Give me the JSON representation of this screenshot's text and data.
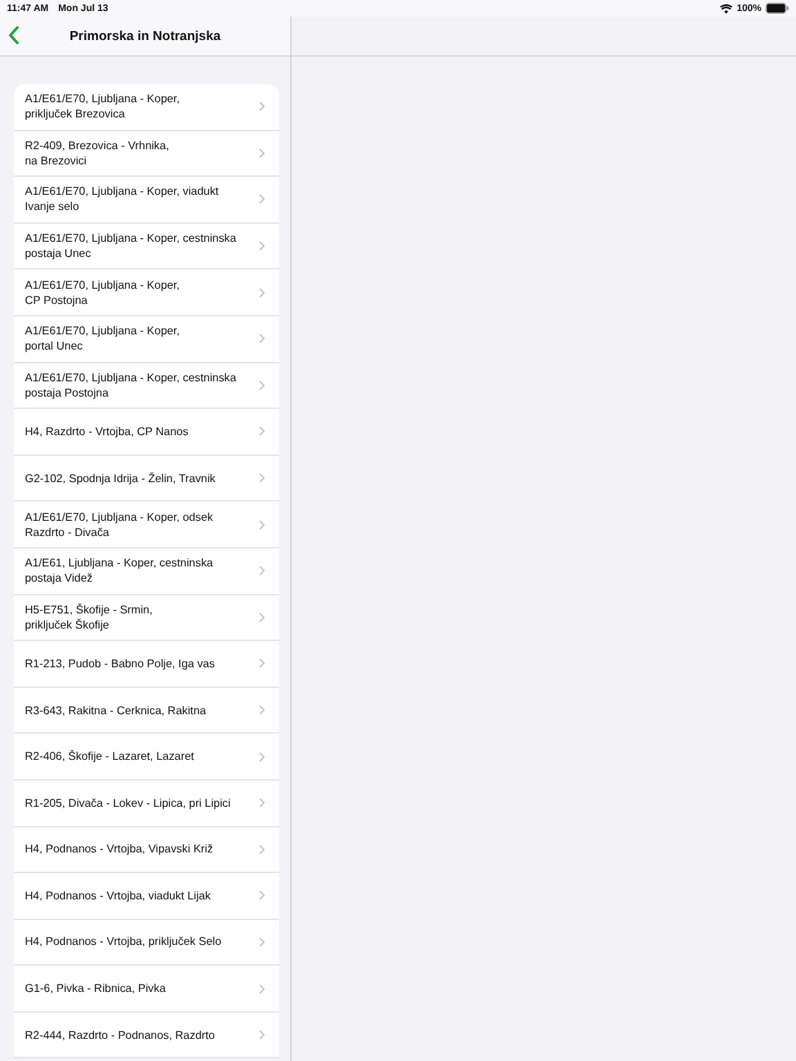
{
  "status_bar": {
    "time": "11:47 AM",
    "date": "Mon Jul 13",
    "battery": "100%"
  },
  "nav": {
    "title": "Primorska in Notranjska"
  },
  "items": [
    {
      "label": "A1/E61/E70, Ljubljana - Koper,\npriključek Brezovica"
    },
    {
      "label": "R2-409, Brezovica - Vrhnika,\nna Brezovici"
    },
    {
      "label": "A1/E61/E70, Ljubljana - Koper, viadukt\nIvanje selo"
    },
    {
      "label": "A1/E61/E70, Ljubljana - Koper, cestninska\npostaja Unec"
    },
    {
      "label": "A1/E61/E70, Ljubljana - Koper,\nCP Postojna"
    },
    {
      "label": "A1/E61/E70, Ljubljana - Koper,\nportal Unec"
    },
    {
      "label": "A1/E61/E70, Ljubljana - Koper, cestninska\npostaja Postojna"
    },
    {
      "label": "H4, Razdrto - Vrtojba, CP Nanos"
    },
    {
      "label": "G2-102, Spodnja Idrija - Želin, Travnik"
    },
    {
      "label": "A1/E61/E70, Ljubljana - Koper, odsek\nRazdrto - Divača"
    },
    {
      "label": "A1/E61, Ljubljana - Koper, cestninska\npostaja Videž"
    },
    {
      "label": "H5-E751, Škofije - Srmin,\npriključek Škofije"
    },
    {
      "label": "R1-213, Pudob - Babno Polje, Iga vas"
    },
    {
      "label": "R3-643, Rakitna - Cerknica, Rakitna"
    },
    {
      "label": "R2-406, Škofije - Lazaret, Lazaret"
    },
    {
      "label": "R1-205, Divača - Lokev - Lipica, pri Lipici"
    },
    {
      "label": "H4, Podnanos - Vrtojba, Vipavski Križ"
    },
    {
      "label": "H4, Podnanos - Vrtojba, viadukt Lijak"
    },
    {
      "label": "H4, Podnanos - Vrtojba, priključek Selo"
    },
    {
      "label": "G1-6, Pivka - Ribnica, Pivka"
    },
    {
      "label": "R2-444, Razdrto - Podnanos, Razdrto"
    }
  ]
}
